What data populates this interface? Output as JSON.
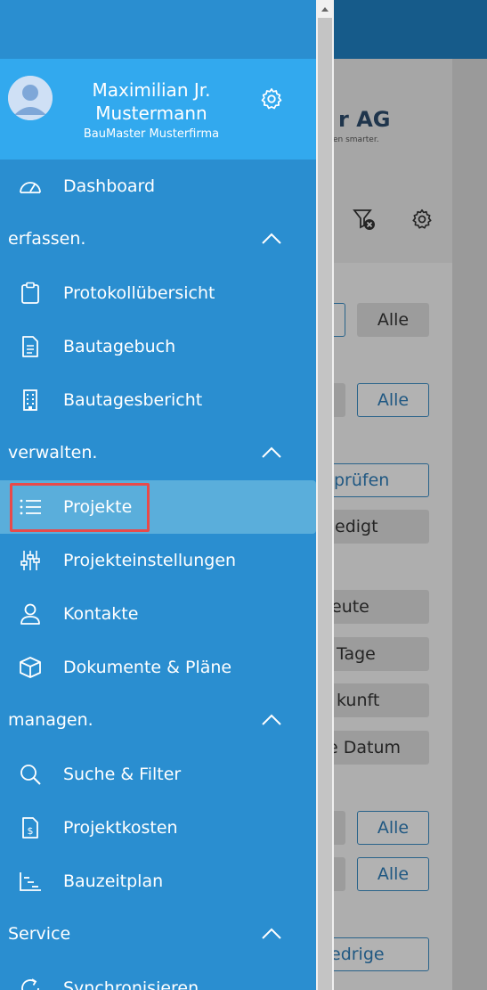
{
  "background": {
    "logo_text": "r AG",
    "logo_sub": "en smarter.",
    "buttons": [
      {
        "label": "Alle",
        "style": "gray"
      },
      {
        "label": "Alle",
        "style": "outline"
      },
      {
        "label": "prüfen",
        "style": "outline"
      },
      {
        "label": "edigt",
        "style": "gray"
      },
      {
        "label": "eute",
        "style": "gray"
      },
      {
        "label": "Tage",
        "style": "gray"
      },
      {
        "label": "kunft",
        "style": "gray"
      },
      {
        "label": "e Datum",
        "style": "gray"
      },
      {
        "label": "Alle",
        "style": "outline"
      },
      {
        "label": "Alle",
        "style": "outline"
      },
      {
        "label": "edrige",
        "style": "outline"
      }
    ]
  },
  "profile": {
    "name": "Maximilian Jr. Mustermann",
    "company": "BauMaster Musterfirma"
  },
  "nav": {
    "dashboard": "Dashboard",
    "sections": {
      "erfassen": "erfassen.",
      "verwalten": "verwalten.",
      "managen": "managen.",
      "service": "Service"
    },
    "items": {
      "protokoll": "Protokollübersicht",
      "bautagebuch": "Bautagebuch",
      "bautagesbericht": "Bautagesbericht",
      "projekte": "Projekte",
      "projekteinstellungen": "Projekteinstellungen",
      "kontakte": "Kontakte",
      "dokumente": "Dokumente & Pläne",
      "suche": "Suche & Filter",
      "projektkosten": "Projektkosten",
      "bauzeitplan": "Bauzeitplan",
      "synchronisieren": "Synchronisieren"
    }
  },
  "colors": {
    "drawer": "#2a8ed0",
    "profile": "#32a9ee",
    "active": "#5aaedb",
    "highlight": "#e84a4a"
  }
}
